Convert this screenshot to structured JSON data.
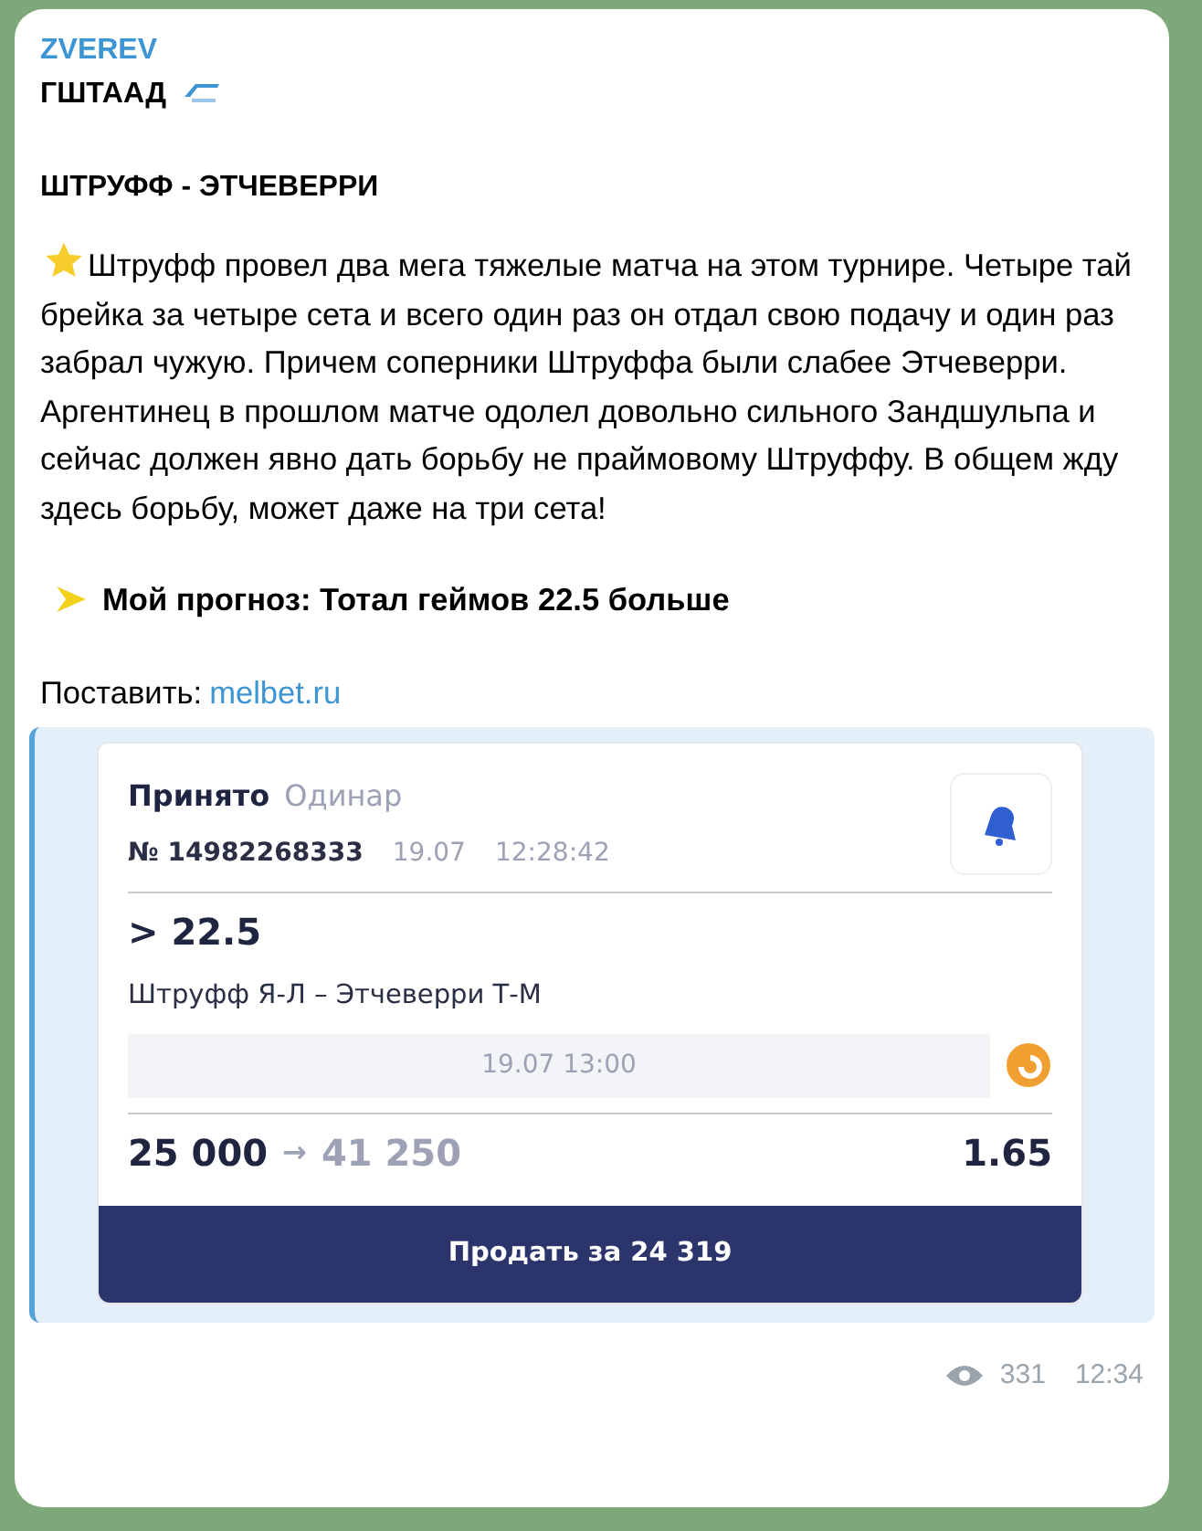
{
  "message": {
    "author": "ZVEREV",
    "heading": "ГШТААД",
    "match": "ШТРУФФ - ЭТЧЕВЕРРИ",
    "body": "Штруфф провел два мега тяжелые матча на этом турнире. Четыре тай брейка за четыре сета и всего один раз он отдал свою подачу и один раз забрал чужую. Причем соперники Штруффа были слабее Этчеверри. Аргентинец в прошлом матче одолел довольно сильного Зандшульпа и сейчас должен явно дать борьбу не праймовому Штруффу. В общем жду здесь борьбу, может даже на три сета!",
    "forecast": "Мой прогноз: Тотал геймов 22.5 больше",
    "link_label": "Поставить:",
    "link": "melbet.ru",
    "views": "331",
    "time": "12:34"
  },
  "bet_slip": {
    "status": "Принято",
    "type": "Одинар",
    "number": "№ 14982268333",
    "date": "19.07",
    "time": "12:28:42",
    "outcome": "> 22.5",
    "event": "Штруфф Я-Л – Этчеверри Т-М",
    "start": "19.07 13:00",
    "stake": "25 000",
    "arrow": "→",
    "payout": "41 250",
    "odds": "1.65",
    "sell_button": "Продать за 24 319"
  }
}
